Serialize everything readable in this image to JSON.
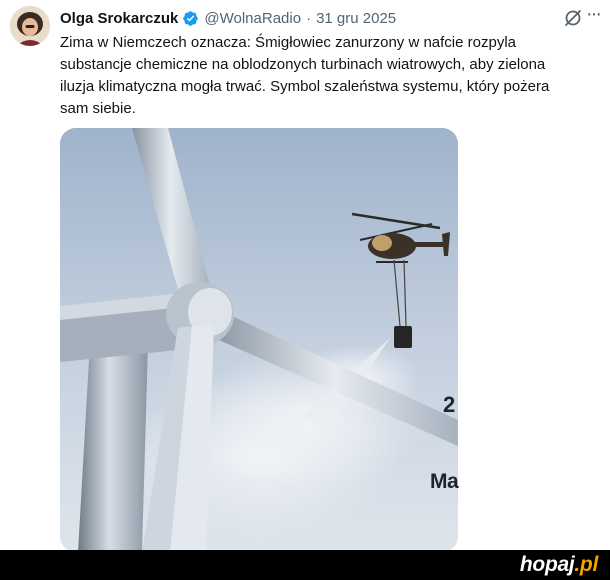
{
  "tweet": {
    "author_name": "Olga Srokarczuk",
    "handle": "@WolnaRadio",
    "separator": "·",
    "date": "31 gru 2025",
    "text_lines": [
      "Zima w Niemczech oznacza: Śmigłowiec zanurzony w nafcie rozpyla",
      "substancje chemiczne na oblodzonych turbinach wiatrowych, aby zielona",
      "iluzja klimatyczna mogła trwać.  Symbol szaleństwa systemu, który pożera",
      "sam siebie."
    ],
    "more_label": "···",
    "media_overlay": {
      "digit": "2",
      "partial": "Ma"
    }
  },
  "footer": {
    "logo_main": "hopaj",
    "logo_suffix": ".pl"
  },
  "colors": {
    "verified": "#1d9bf0",
    "muted": "#536471",
    "text": "#0f1419",
    "logo_accent": "#f2a100"
  },
  "icons": [
    "verified-badge-icon",
    "grok-icon",
    "more-icon"
  ]
}
